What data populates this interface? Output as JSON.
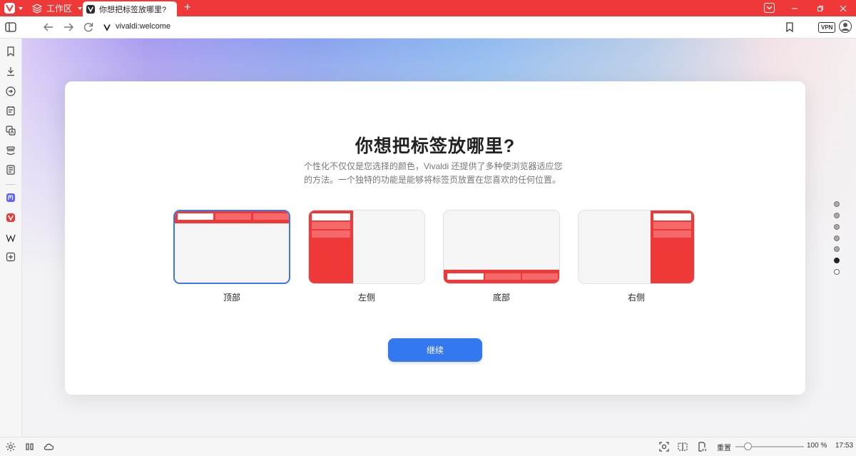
{
  "titlebar": {
    "workspace_label": "工作区",
    "tab_title": "你想把标签放哪里?",
    "new_tab_symbol": "+"
  },
  "addressbar": {
    "url": "vivaldi:welcome",
    "vpn_label": "VPN"
  },
  "welcome": {
    "heading": "你想把标签放哪里?",
    "description": "个性化不仅仅是您选择的颜色，Vivaldi 还提供了多种使浏览器适应您的方法。一个独特的功能是能够将标签页放置在您喜欢的任何位置。",
    "options": [
      {
        "label": "顶部",
        "selected": true
      },
      {
        "label": "左侧",
        "selected": false
      },
      {
        "label": "底部",
        "selected": false
      },
      {
        "label": "右侧",
        "selected": false
      }
    ],
    "continue_label": "继续",
    "progress_step": 6,
    "progress_total": 7
  },
  "statusbar": {
    "reset_label": "重置",
    "zoom": "100 %",
    "zoom_level": 0.5,
    "time": "17:53"
  },
  "colors": {
    "brand_red": "#ef3939",
    "accent_blue": "#3478f0",
    "selected_border": "#3b78e7"
  },
  "icons": {
    "sidebar": [
      "bookmark-icon",
      "download-icon",
      "history-icon",
      "notes-icon",
      "translate-icon",
      "reading-list-icon",
      "calendar-icon",
      "mastodon-icon",
      "vivaldi-icon",
      "wikipedia-icon",
      "add-panel-icon"
    ]
  }
}
